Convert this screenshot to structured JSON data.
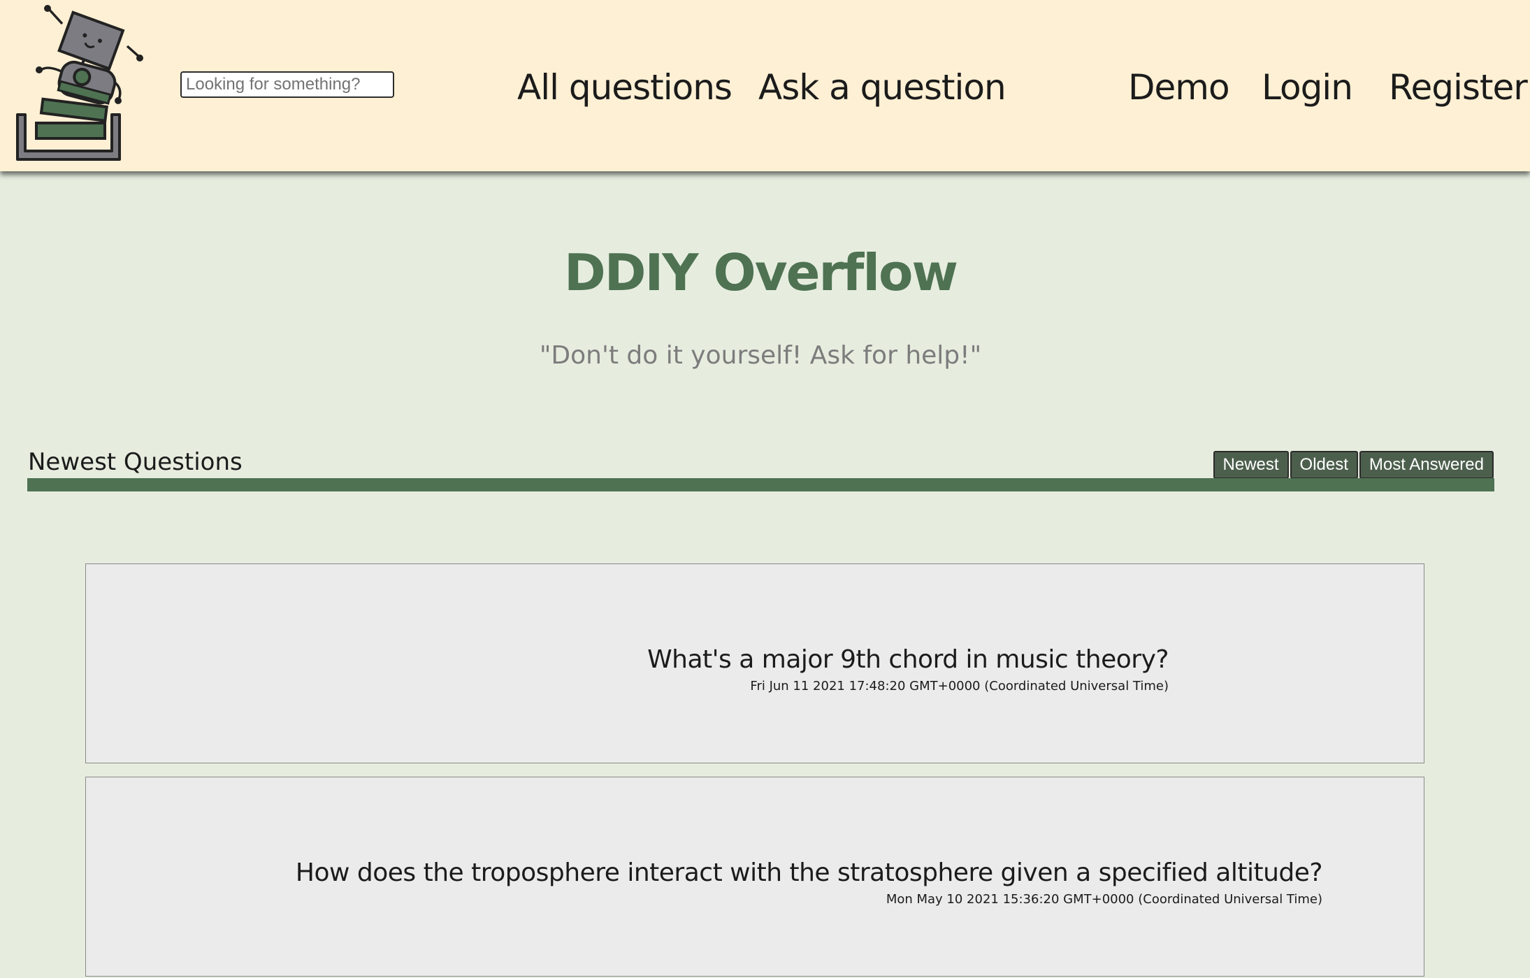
{
  "header": {
    "logo_icon": "robot-in-box-logo",
    "search": {
      "placeholder": "Looking for something?",
      "value": ""
    },
    "nav": {
      "all_questions": "All questions",
      "ask_question": "Ask a question",
      "demo": "Demo",
      "login": "Login",
      "register": "Register"
    },
    "colors": {
      "background": "#fef0d4"
    }
  },
  "hero": {
    "title": "DDIY Overflow",
    "tagline": "\"Don't do it yourself! Ask for help!\"",
    "colors": {
      "title": "#4e7252",
      "tagline": "#7c7c7c"
    }
  },
  "questions_section": {
    "title": "Newest Questions",
    "sort_buttons": [
      "Newest",
      "Oldest",
      "Most Answered"
    ],
    "colors": {
      "bar": "#4e7252",
      "button": "#4c5f4d"
    }
  },
  "questions": [
    {
      "title": "What's a major 9th chord in music theory?",
      "date": "Fri Jun 11 2021 17:48:20 GMT+0000 (Coordinated Universal Time)"
    },
    {
      "title": "How does the troposphere interact with the stratosphere given a specified altitude?",
      "date": "Mon May 10 2021 15:36:20 GMT+0000 (Coordinated Universal Time)"
    }
  ]
}
